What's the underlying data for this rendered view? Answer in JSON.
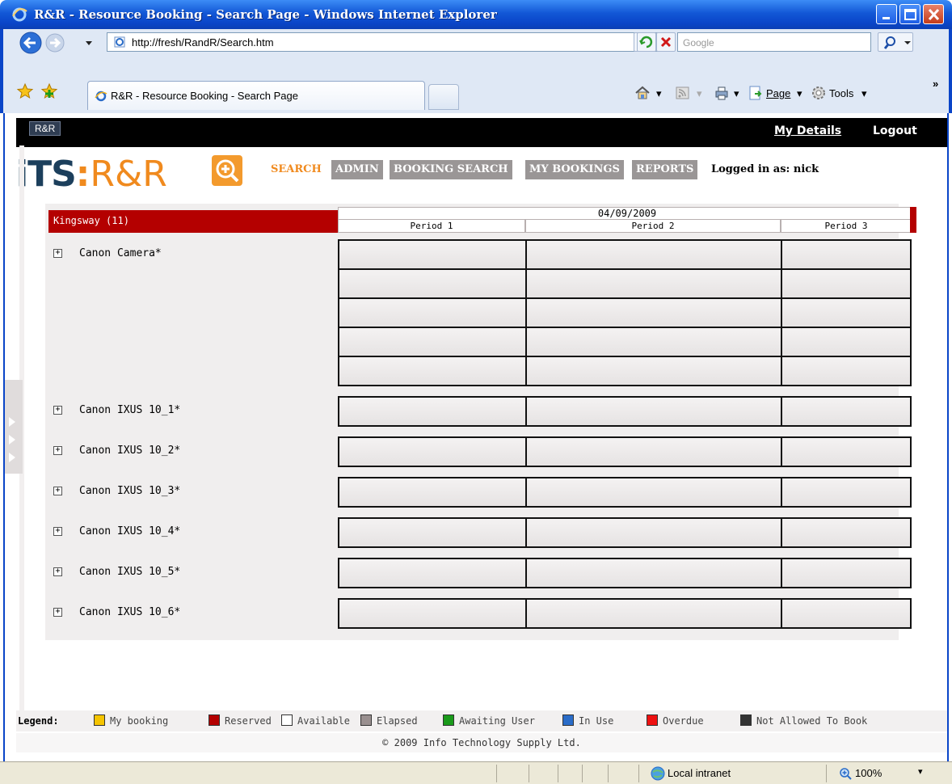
{
  "window": {
    "title": "R&R - Resource Booking - Search Page - Windows Internet Explorer",
    "url": "http://fresh/RandR/Search.htm",
    "search_placeholder": "Google",
    "tab_title": "R&R - Resource Booking - Search Page",
    "commands": {
      "page": "Page",
      "tools": "Tools"
    }
  },
  "topbar": {
    "tag": "R&R",
    "my_details": "My Details",
    "logout": "Logout"
  },
  "logo": {
    "its": "iTS",
    "colon": ":",
    "rr": "R&R"
  },
  "menu": {
    "search": "SEARCH",
    "admin": "ADMIN",
    "booking_search": "BOOKING SEARCH",
    "my_bookings": "MY BOOKINGS",
    "reports": "REPORTS",
    "logged_in": "Logged in as: nick"
  },
  "grid": {
    "location": "Kingsway (11)",
    "date": "04/09/2009",
    "periods": [
      "Period 1",
      "Period 2",
      "Period 3"
    ],
    "resources": [
      {
        "name": "Canon Camera*",
        "slots": 5
      },
      {
        "name": "Canon IXUS 10_1*",
        "slots": 1
      },
      {
        "name": "Canon IXUS 10_2*",
        "slots": 1
      },
      {
        "name": "Canon IXUS 10_3*",
        "slots": 1
      },
      {
        "name": "Canon IXUS 10_4*",
        "slots": 1
      },
      {
        "name": "Canon IXUS 10_5*",
        "slots": 1
      },
      {
        "name": "Canon IXUS 10_6*",
        "slots": 1
      }
    ]
  },
  "legend": {
    "label": "Legend:",
    "items": [
      {
        "text": "My booking",
        "color": "#f5c400"
      },
      {
        "text": "Reserved",
        "color": "#b40000"
      },
      {
        "text": "Available",
        "color": "#ffffff"
      },
      {
        "text": "Elapsed",
        "color": "#9a9090"
      },
      {
        "text": "Awaiting User",
        "color": "#1a9a1a"
      },
      {
        "text": "In Use",
        "color": "#2a6cc8"
      },
      {
        "text": "Overdue",
        "color": "#ee1111"
      },
      {
        "text": "Not Allowed To Book",
        "color": "#333333"
      }
    ]
  },
  "footer": {
    "copyright": "© 2009 Info Technology Supply Ltd."
  },
  "statusbar": {
    "zone": "Local intranet",
    "zoom": "100%"
  }
}
